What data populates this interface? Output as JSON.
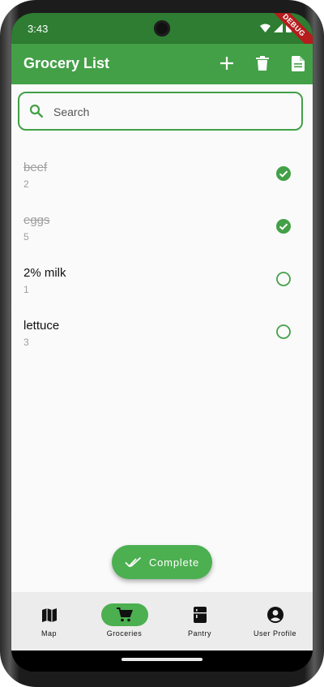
{
  "status": {
    "time": "3:43",
    "debug_label": "DEBUG"
  },
  "appbar": {
    "title": "Grocery List",
    "actions": [
      {
        "name": "add",
        "icon": "plus-icon"
      },
      {
        "name": "delete",
        "icon": "trash-icon"
      },
      {
        "name": "file",
        "icon": "document-icon"
      }
    ]
  },
  "search": {
    "placeholder": "Search",
    "value": ""
  },
  "items": [
    {
      "name": "beef",
      "quantity": "2",
      "checked": true
    },
    {
      "name": "eggs",
      "quantity": "5",
      "checked": true
    },
    {
      "name": "2% milk",
      "quantity": "1",
      "checked": false
    },
    {
      "name": "lettuce",
      "quantity": "3",
      "checked": false
    }
  ],
  "fab": {
    "label": "Complete",
    "icon": "double-check-icon"
  },
  "bottom_nav": {
    "items": [
      {
        "label": "Map",
        "icon": "map-icon",
        "active": false
      },
      {
        "label": "Groceries",
        "icon": "cart-icon",
        "active": true
      },
      {
        "label": "Pantry",
        "icon": "fridge-icon",
        "active": false
      },
      {
        "label": "User Profile",
        "icon": "account-circle-icon",
        "active": false
      }
    ]
  },
  "colors": {
    "primary": "#43a047",
    "primary_dark": "#2e7d32",
    "fab": "#4caf50",
    "debug_ribbon": "#b71c1c"
  }
}
